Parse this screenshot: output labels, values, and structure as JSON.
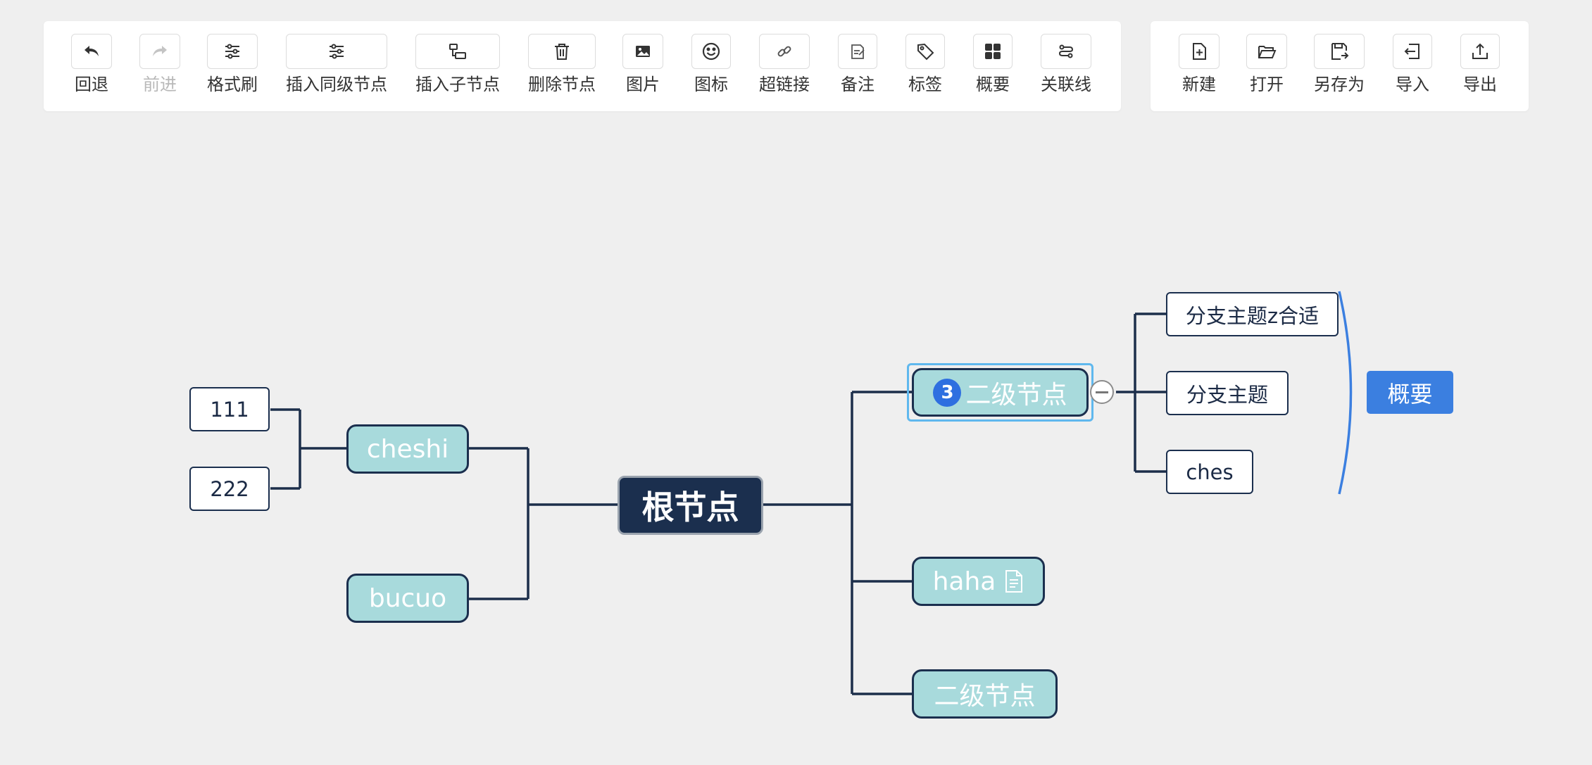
{
  "toolbar": {
    "main": [
      {
        "id": "undo",
        "label": "回退",
        "icon": "undo-icon",
        "disabled": false
      },
      {
        "id": "redo",
        "label": "前进",
        "icon": "redo-icon",
        "disabled": true
      },
      {
        "id": "format-brush",
        "label": "格式刷",
        "icon": "sliders-icon",
        "disabled": false
      },
      {
        "id": "insert-sibling",
        "label": "插入同级节点",
        "icon": "sliders-icon",
        "disabled": false
      },
      {
        "id": "insert-child",
        "label": "插入子节点",
        "icon": "child-node-icon",
        "disabled": false
      },
      {
        "id": "delete-node",
        "label": "删除节点",
        "icon": "trash-icon",
        "disabled": false
      },
      {
        "id": "image",
        "label": "图片",
        "icon": "image-icon",
        "disabled": false
      },
      {
        "id": "icon",
        "label": "图标",
        "icon": "smiley-icon",
        "disabled": false
      },
      {
        "id": "hyperlink",
        "label": "超链接",
        "icon": "link-icon",
        "disabled": false
      },
      {
        "id": "note",
        "label": "备注",
        "icon": "note-edit-icon",
        "disabled": false
      },
      {
        "id": "tag",
        "label": "标签",
        "icon": "tag-icon",
        "disabled": false
      },
      {
        "id": "summary",
        "label": "概要",
        "icon": "grid-icon",
        "disabled": false
      },
      {
        "id": "association",
        "label": "关联线",
        "icon": "association-line-icon",
        "disabled": false
      }
    ],
    "file": [
      {
        "id": "new",
        "label": "新建",
        "icon": "new-file-icon"
      },
      {
        "id": "open",
        "label": "打开",
        "icon": "folder-open-icon"
      },
      {
        "id": "save-as",
        "label": "另存为",
        "icon": "save-as-icon"
      },
      {
        "id": "import",
        "label": "导入",
        "icon": "import-icon"
      },
      {
        "id": "export",
        "label": "导出",
        "icon": "export-icon"
      }
    ]
  },
  "mindmap": {
    "root": {
      "text": "根节点"
    },
    "left": [
      {
        "text": "cheshi",
        "children": [
          {
            "text": "111"
          },
          {
            "text": "222"
          }
        ]
      },
      {
        "text": "bucuo",
        "children": []
      }
    ],
    "right": [
      {
        "text": "二级节点",
        "badge": "3",
        "selected": true,
        "collapsible": true,
        "children": [
          {
            "text": "分支主题z合适"
          },
          {
            "text": "分支主题"
          },
          {
            "text": "ches"
          }
        ],
        "summary": "概要"
      },
      {
        "text": "haha",
        "has_note": true,
        "children": []
      },
      {
        "text": "二级节点",
        "children": []
      }
    ]
  },
  "colors": {
    "background": "#efefef",
    "root_fill": "#1b2f4e",
    "second_fill": "#a8dadc",
    "line": "#1c2e4a",
    "summary_fill": "#3b7fe0",
    "selection": "#5fb8ee",
    "badge": "#2e6fe0"
  }
}
